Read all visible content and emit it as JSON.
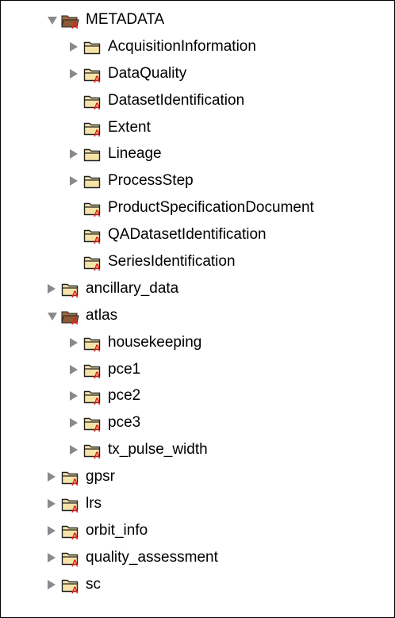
{
  "tree": {
    "items": [
      {
        "label": "METADATA",
        "level": 0,
        "expandable": true,
        "expanded": true,
        "open_folder": true,
        "badge": true
      },
      {
        "label": "AcquisitionInformation",
        "level": 1,
        "expandable": true,
        "expanded": false,
        "badge": false
      },
      {
        "label": "DataQuality",
        "level": 1,
        "expandable": true,
        "expanded": false,
        "badge": true
      },
      {
        "label": "DatasetIdentification",
        "level": 1,
        "expandable": false,
        "expanded": false,
        "badge": true
      },
      {
        "label": "Extent",
        "level": 1,
        "expandable": false,
        "expanded": false,
        "badge": true
      },
      {
        "label": "Lineage",
        "level": 1,
        "expandable": true,
        "expanded": false,
        "badge": false
      },
      {
        "label": "ProcessStep",
        "level": 1,
        "expandable": true,
        "expanded": false,
        "badge": false
      },
      {
        "label": "ProductSpecificationDocument",
        "level": 1,
        "expandable": false,
        "expanded": false,
        "badge": true
      },
      {
        "label": "QADatasetIdentification",
        "level": 1,
        "expandable": false,
        "expanded": false,
        "badge": true
      },
      {
        "label": "SeriesIdentification",
        "level": 1,
        "expandable": false,
        "expanded": false,
        "badge": true
      },
      {
        "label": "ancillary_data",
        "level": 0,
        "expandable": true,
        "expanded": false,
        "badge": true
      },
      {
        "label": "atlas",
        "level": 0,
        "expandable": true,
        "expanded": true,
        "open_folder": true,
        "badge": true
      },
      {
        "label": "housekeeping",
        "level": 1,
        "expandable": true,
        "expanded": false,
        "badge": true
      },
      {
        "label": "pce1",
        "level": 1,
        "expandable": true,
        "expanded": false,
        "badge": true
      },
      {
        "label": "pce2",
        "level": 1,
        "expandable": true,
        "expanded": false,
        "badge": true
      },
      {
        "label": "pce3",
        "level": 1,
        "expandable": true,
        "expanded": false,
        "badge": true
      },
      {
        "label": "tx_pulse_width",
        "level": 1,
        "expandable": true,
        "expanded": false,
        "badge": true
      },
      {
        "label": "gpsr",
        "level": 0,
        "expandable": true,
        "expanded": false,
        "badge": true
      },
      {
        "label": "lrs",
        "level": 0,
        "expandable": true,
        "expanded": false,
        "badge": true
      },
      {
        "label": "orbit_info",
        "level": 0,
        "expandable": true,
        "expanded": false,
        "badge": true
      },
      {
        "label": "quality_assessment",
        "level": 0,
        "expandable": true,
        "expanded": false,
        "badge": true
      },
      {
        "label": "sc",
        "level": 0,
        "expandable": true,
        "expanded": false,
        "badge": true
      }
    ]
  },
  "icons": {
    "folder": "folder-icon",
    "open_folder": "folder-open-icon",
    "badge": "attribute-a-badge",
    "collapsed": "disclosure-triangle-collapsed-icon",
    "expanded": "disclosure-triangle-expanded-icon"
  },
  "colors": {
    "folder_fill": "#f6e3a8",
    "folder_stroke": "#222222",
    "open_folder_fill": "#a06a44",
    "badge": "#e0231c",
    "triangle": "#8a8a8a"
  }
}
